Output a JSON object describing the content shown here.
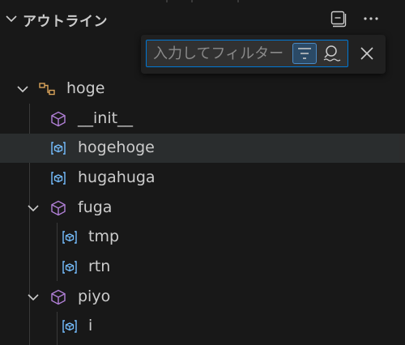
{
  "header": {
    "title": "アウトライン"
  },
  "filter": {
    "placeholder": "入力してフィルター"
  },
  "icons": {
    "collapse": "collapse-all-icon",
    "more": "more-actions-icon",
    "filter": "filter-icon",
    "fuzzy": "fuzzy-search-icon",
    "close": "close-icon",
    "namespace": "symbol-namespace-icon",
    "module": "symbol-module-icon",
    "variable": "symbol-variable-icon"
  },
  "colors": {
    "accent": "#0078d4",
    "namespace": "#d9a35a",
    "module": "#b180d7",
    "variable": "#75beff"
  },
  "tree": {
    "items": [
      {
        "label": "hoge",
        "kind": "namespace",
        "expanded": true
      },
      {
        "label": "__init__",
        "kind": "module"
      },
      {
        "label": "hogehoge",
        "kind": "variable",
        "selected": true
      },
      {
        "label": "hugahuga",
        "kind": "variable"
      },
      {
        "label": "fuga",
        "kind": "module",
        "expanded": true
      },
      {
        "label": "tmp",
        "kind": "variable"
      },
      {
        "label": "rtn",
        "kind": "variable"
      },
      {
        "label": "piyo",
        "kind": "module",
        "expanded": true
      },
      {
        "label": "i",
        "kind": "variable"
      }
    ]
  }
}
